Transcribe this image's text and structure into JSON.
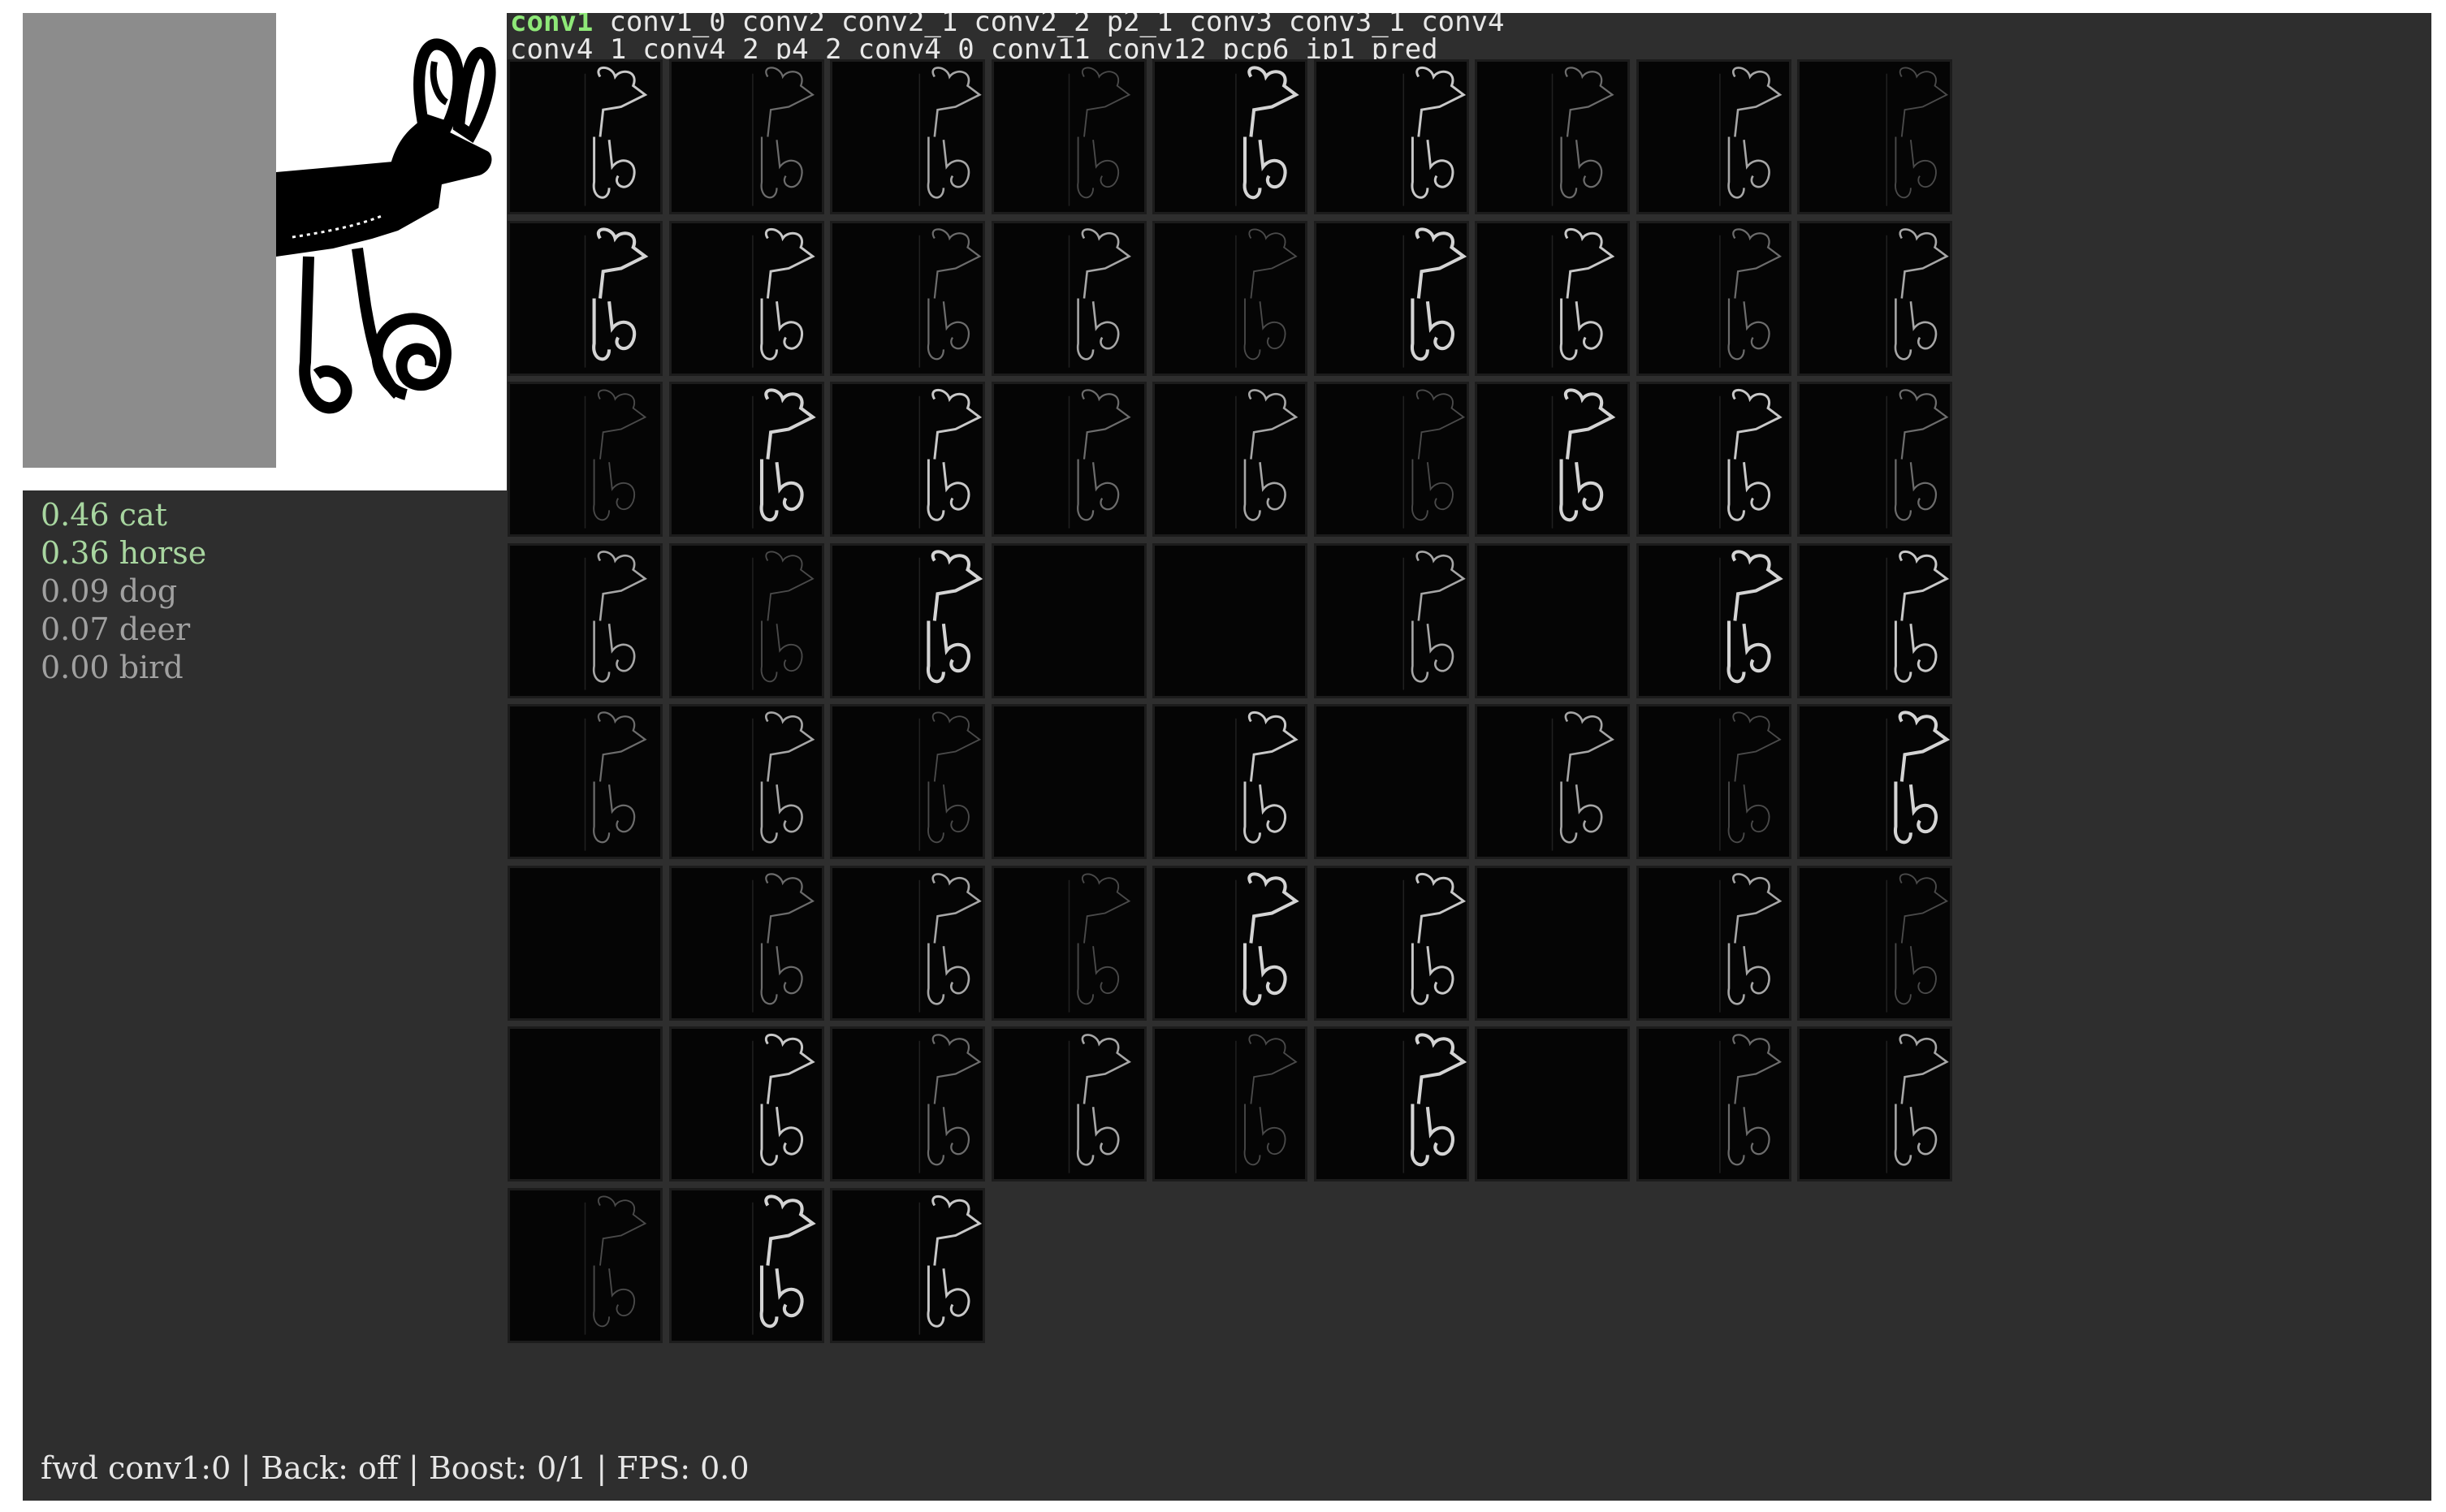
{
  "layer_tabs": {
    "row1": [
      "conv1",
      "conv1_0",
      "conv2",
      "conv2_1",
      "conv2_2",
      "p2_1",
      "conv3",
      "conv3_1",
      "conv4"
    ],
    "row2": [
      "conv4_1",
      "conv4_2",
      "p4_2",
      "conv4_0",
      "conv11",
      "conv12",
      "pcp6",
      "ip1",
      "pred"
    ],
    "active": "conv1"
  },
  "predictions": [
    {
      "score": "0.46",
      "label": "cat",
      "color": "#a8d6a0"
    },
    {
      "score": "0.36",
      "label": "horse",
      "color": "#a8d6a0"
    },
    {
      "score": "0.09",
      "label": "dog",
      "color": "#a0a0a0"
    },
    {
      "score": "0.07",
      "label": "deer",
      "color": "#a0a0a0"
    },
    {
      "score": "0.00",
      "label": "bird",
      "color": "#a0a0a0"
    }
  ],
  "feature_map_count": 66,
  "status_bar": {
    "text": "fwd conv1:0 | Back: off | Boost: 0/1 | FPS: 0.0"
  },
  "colors": {
    "background": "#2e2e2e",
    "active_tab": "#8ee878",
    "tab_text": "#e8e8e8"
  },
  "icons": [
    "input-image-sketch",
    "feature-map-thumbnail"
  ]
}
